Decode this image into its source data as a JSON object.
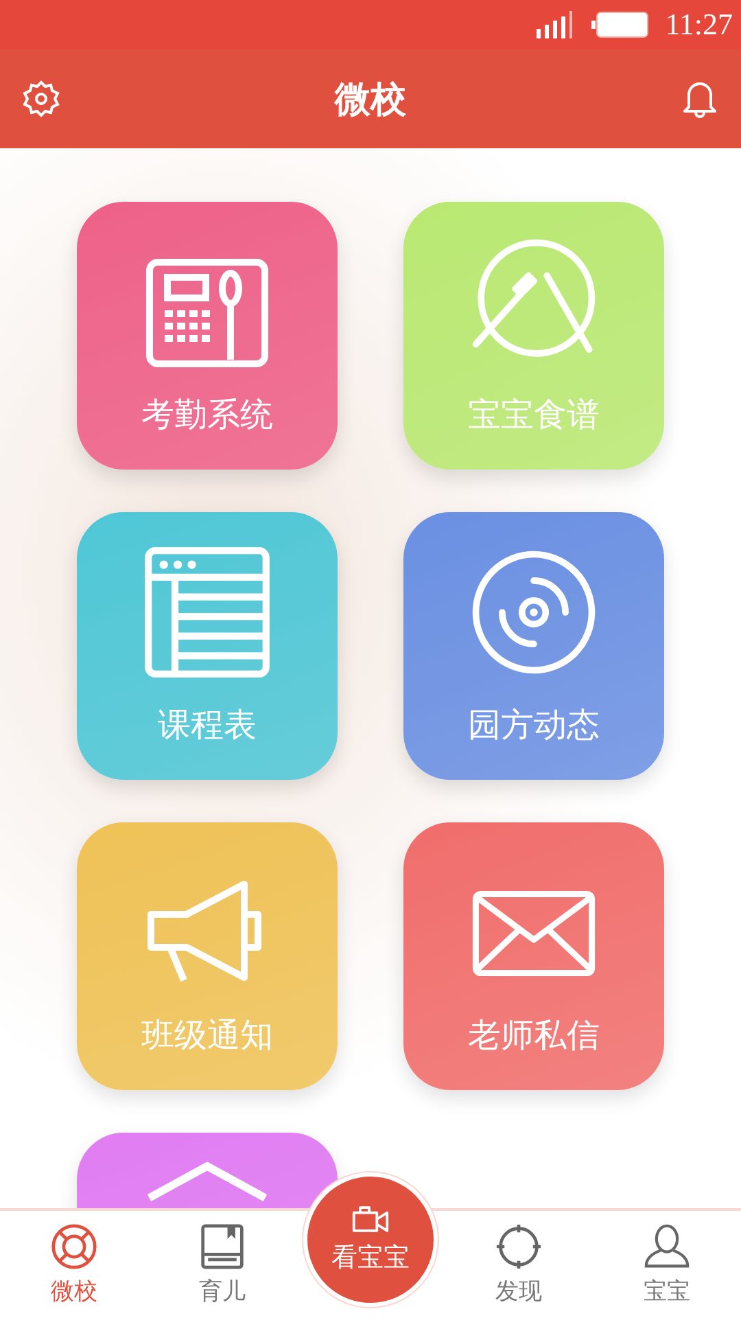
{
  "status_bar": {
    "time": "11:27"
  },
  "header": {
    "title": "微校"
  },
  "tiles": [
    {
      "kind": "attendance",
      "label": "考勤系统",
      "color": "#ee6189"
    },
    {
      "kind": "recipe",
      "label": "宝宝食谱",
      "color": "#b9e872"
    },
    {
      "kind": "schedule",
      "label": "课程表",
      "color": "#4fc7d6"
    },
    {
      "kind": "news",
      "label": "园方动态",
      "color": "#6b90e2"
    },
    {
      "kind": "notice",
      "label": "班级通知",
      "color": "#efc257"
    },
    {
      "kind": "message",
      "label": "老师私信",
      "color": "#f06e6c"
    },
    {
      "kind": "house",
      "color": "#e07df2"
    }
  ],
  "tabs": [
    {
      "kind": "school",
      "label": "微校",
      "selected": true
    },
    {
      "kind": "book",
      "label": "育儿",
      "selected": false
    },
    {
      "kind": "camera",
      "label": "看宝宝",
      "selected": false
    },
    {
      "kind": "discover",
      "label": "发现",
      "selected": false
    },
    {
      "kind": "profile",
      "label": "宝宝",
      "selected": false
    }
  ]
}
